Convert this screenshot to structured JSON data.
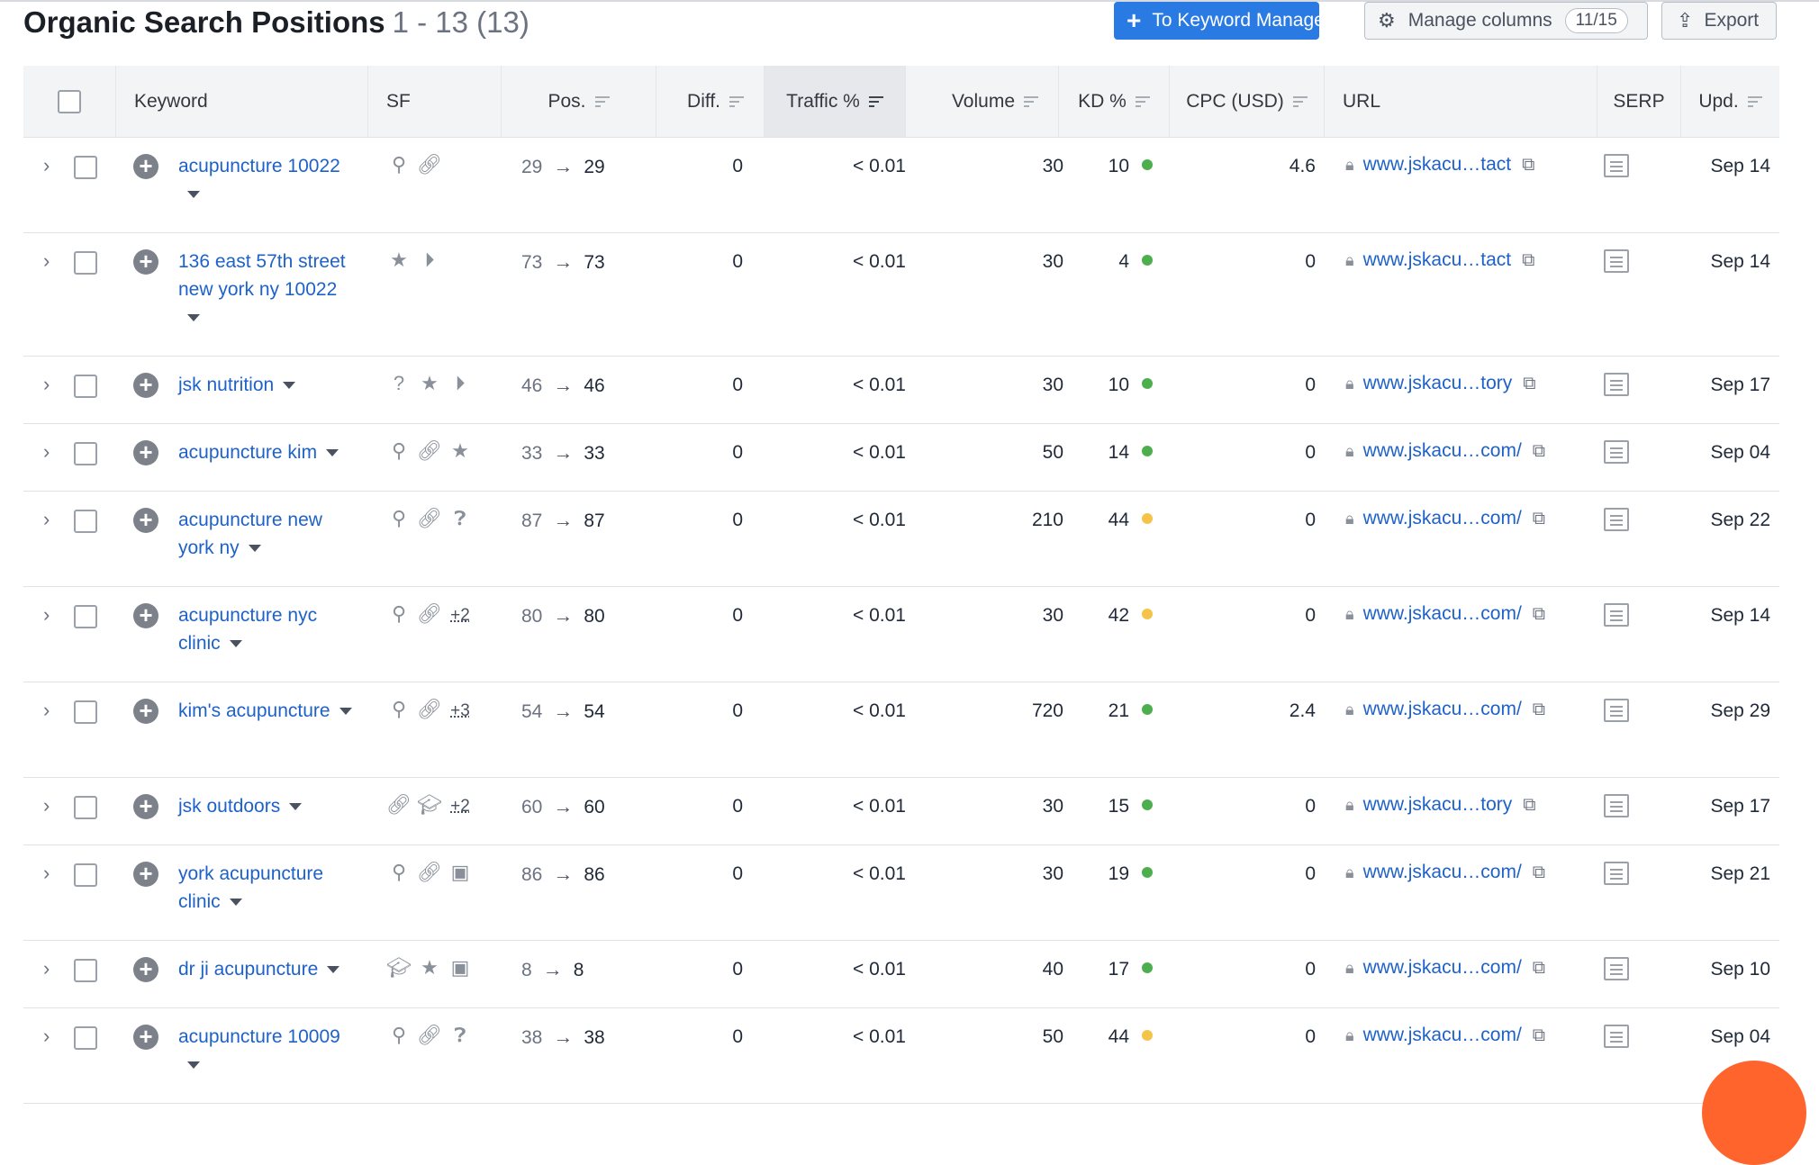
{
  "header": {
    "title": "Organic Search Positions",
    "count": "1 - 13 (13)",
    "keyword_manager_label": "To Keyword Manager",
    "manage_columns_label": "Manage columns",
    "manage_columns_badge": "11/15",
    "export_label": "Export"
  },
  "columns": {
    "keyword": "Keyword",
    "sf": "SF",
    "pos": "Pos.",
    "diff": "Diff.",
    "traffic": "Traffic %",
    "volume": "Volume",
    "kd": "KD %",
    "cpc": "CPC (USD)",
    "url": "URL",
    "serp": "SERP",
    "upd": "Upd."
  },
  "colors": {
    "kd_green": "#4cae4c",
    "kd_yellow": "#f4c44a",
    "link": "#1e62c9",
    "primary": "#2a7ae4"
  },
  "rows": [
    {
      "keyword": "acupuncture 10022",
      "sf": [
        "location-icon",
        "link-icon"
      ],
      "sf_more": "",
      "pos_from": "29",
      "pos_to": "29",
      "diff": "0",
      "traffic": "< 0.01",
      "volume": "30",
      "kd": "10",
      "kd_color": "#4cae4c",
      "cpc": "4.6",
      "url": "www.jskacu…tact",
      "upd": "Sep 14"
    },
    {
      "keyword": "136 east 57th street new york ny 10022",
      "sf": [
        "star-icon",
        "video-icon"
      ],
      "sf_more": "",
      "pos_from": "73",
      "pos_to": "73",
      "diff": "0",
      "traffic": "< 0.01",
      "volume": "30",
      "kd": "4",
      "kd_color": "#4cae4c",
      "cpc": "0",
      "url": "www.jskacu…tact",
      "upd": "Sep 14"
    },
    {
      "keyword": "jsk nutrition",
      "sf": [
        "question-icon",
        "star-icon",
        "video-icon"
      ],
      "sf_more": "",
      "pos_from": "46",
      "pos_to": "46",
      "diff": "0",
      "traffic": "< 0.01",
      "volume": "30",
      "kd": "10",
      "kd_color": "#4cae4c",
      "cpc": "0",
      "url": "www.jskacu…tory",
      "upd": "Sep 17"
    },
    {
      "keyword": "acupuncture kim",
      "sf": [
        "location-icon",
        "link-icon",
        "star-icon"
      ],
      "sf_more": "",
      "pos_from": "33",
      "pos_to": "33",
      "diff": "0",
      "traffic": "< 0.01",
      "volume": "50",
      "kd": "14",
      "kd_color": "#4cae4c",
      "cpc": "0",
      "url": "www.jskacu…com/",
      "upd": "Sep 04"
    },
    {
      "keyword": "acupuncture new york ny",
      "sf": [
        "location-icon",
        "link-icon",
        "faq-icon"
      ],
      "sf_more": "",
      "pos_from": "87",
      "pos_to": "87",
      "diff": "0",
      "traffic": "< 0.01",
      "volume": "210",
      "kd": "44",
      "kd_color": "#f4c44a",
      "cpc": "0",
      "url": "www.jskacu…com/",
      "upd": "Sep 22"
    },
    {
      "keyword": "acupuncture nyc clinic",
      "sf": [
        "location-icon",
        "link-icon"
      ],
      "sf_more": "+2",
      "pos_from": "80",
      "pos_to": "80",
      "diff": "0",
      "traffic": "< 0.01",
      "volume": "30",
      "kd": "42",
      "kd_color": "#f4c44a",
      "cpc": "0",
      "url": "www.jskacu…com/",
      "upd": "Sep 14"
    },
    {
      "keyword": "kim's acupuncture",
      "sf": [
        "location-icon",
        "link-icon"
      ],
      "sf_more": "+3",
      "pos_from": "54",
      "pos_to": "54",
      "diff": "0",
      "traffic": "< 0.01",
      "volume": "720",
      "kd": "21",
      "kd_color": "#4cae4c",
      "cpc": "2.4",
      "url": "www.jskacu…com/",
      "upd": "Sep 29"
    },
    {
      "keyword": "jsk outdoors",
      "sf": [
        "link-icon",
        "knowledge-icon"
      ],
      "sf_more": "+2",
      "pos_from": "60",
      "pos_to": "60",
      "diff": "0",
      "traffic": "< 0.01",
      "volume": "30",
      "kd": "15",
      "kd_color": "#4cae4c",
      "cpc": "0",
      "url": "www.jskacu…tory",
      "upd": "Sep 17"
    },
    {
      "keyword": "york acupuncture clinic",
      "sf": [
        "location-icon",
        "link-icon",
        "ad-icon"
      ],
      "sf_more": "",
      "pos_from": "86",
      "pos_to": "86",
      "diff": "0",
      "traffic": "< 0.01",
      "volume": "30",
      "kd": "19",
      "kd_color": "#4cae4c",
      "cpc": "0",
      "url": "www.jskacu…com/",
      "upd": "Sep 21"
    },
    {
      "keyword": "dr ji acupuncture",
      "sf": [
        "knowledge-icon",
        "star-icon",
        "ad-icon"
      ],
      "sf_more": "",
      "pos_from": "8",
      "pos_to": "8",
      "diff": "0",
      "traffic": "< 0.01",
      "volume": "40",
      "kd": "17",
      "kd_color": "#4cae4c",
      "cpc": "0",
      "url": "www.jskacu…com/",
      "upd": "Sep 10"
    },
    {
      "keyword": "acupuncture 10009",
      "sf": [
        "location-icon",
        "link-icon",
        "faq-icon"
      ],
      "sf_more": "",
      "pos_from": "38",
      "pos_to": "38",
      "diff": "0",
      "traffic": "< 0.01",
      "volume": "50",
      "kd": "44",
      "kd_color": "#f4c44a",
      "cpc": "0",
      "url": "www.jskacu…com/",
      "upd": "Sep 04"
    }
  ]
}
